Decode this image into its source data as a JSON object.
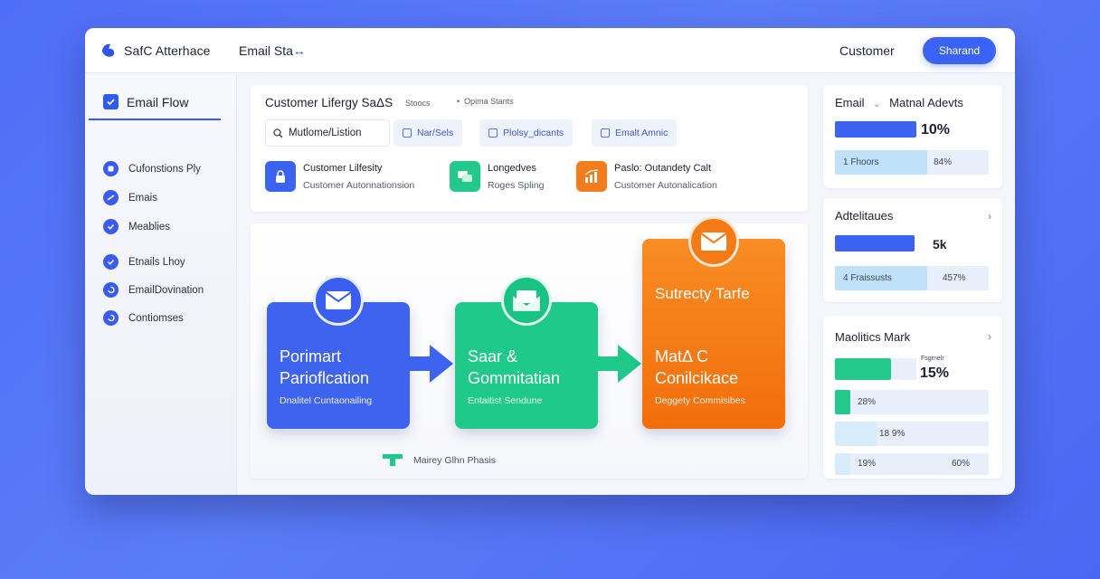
{
  "header": {
    "app_title": "SafC Atterhace",
    "nav_label": "Email Sta",
    "nav_mark": "↔",
    "customer_label": "Customer",
    "button_label": "Sharand"
  },
  "sidebar": {
    "heading": "Email Flow",
    "items": [
      {
        "label": "Cufonstions Ply"
      },
      {
        "label": "Emais"
      },
      {
        "label": "Meablies"
      },
      {
        "label": "Etnails Lhoy"
      },
      {
        "label": "EmailDovination"
      },
      {
        "label": "Contiomses"
      }
    ]
  },
  "main": {
    "title": "Customer Lifergy SaΔS",
    "subtitle": "Stoocs",
    "bullet": "Opima Stants",
    "search": {
      "value": "Mutlome/Listion"
    },
    "chips": [
      {
        "label": "Nar/Sels"
      },
      {
        "label": "Plolsy_dicants"
      },
      {
        "label": "Emalt Amnic"
      }
    ],
    "features": [
      {
        "title": "Customer Lilfesity",
        "subtitle": "Customer Autonnationsion",
        "color": "#3b63f0"
      },
      {
        "title": "Longedves",
        "subtitle": "Roges Spling",
        "color": "#22c98a"
      },
      {
        "title": "Paslo: Outandety Calt",
        "subtitle": "Customer Autonalication",
        "color": "#f57c1c"
      }
    ]
  },
  "flow": {
    "steps": [
      {
        "title_line1": "Porimart",
        "title_line2": "Parioflcation",
        "subtitle": "Dnalitel Cuntaonailing",
        "color": "#3e63ef"
      },
      {
        "title_line1": "Saar &",
        "title_line2": "Gommitatian",
        "subtitle": "Entaitist Sendune",
        "color": "#1fc98a"
      },
      {
        "title_line0": "Sutrecty Tarfe",
        "title_line1": "MatΔ C",
        "title_line2": "Conilcikace",
        "subtitle": "Deggety Commisibes",
        "color": "#f47a15"
      }
    ],
    "footnote": "Mairey Glhn Phasis"
  },
  "right": {
    "panel1": {
      "title": "Email",
      "title2": "Matnal Adevts",
      "value": "10%",
      "row_label": "1 Fhoors",
      "row_value": "84%",
      "row_fill": 0.6
    },
    "panel2": {
      "title": "Adtelitaues",
      "value": "5k",
      "row_label": "4 Fraissusts",
      "row_value": "457%",
      "row_fill": 0.6
    },
    "panel3": {
      "title": "Maolitics Mark",
      "caption": "Fsgrnelr",
      "value": "15%",
      "rows": [
        {
          "label": "28%",
          "fill": 0.1
        },
        {
          "label": "18 9%",
          "fill": 0.27
        },
        {
          "label": "19%",
          "value": "60%",
          "fill": 0.1
        }
      ]
    }
  }
}
